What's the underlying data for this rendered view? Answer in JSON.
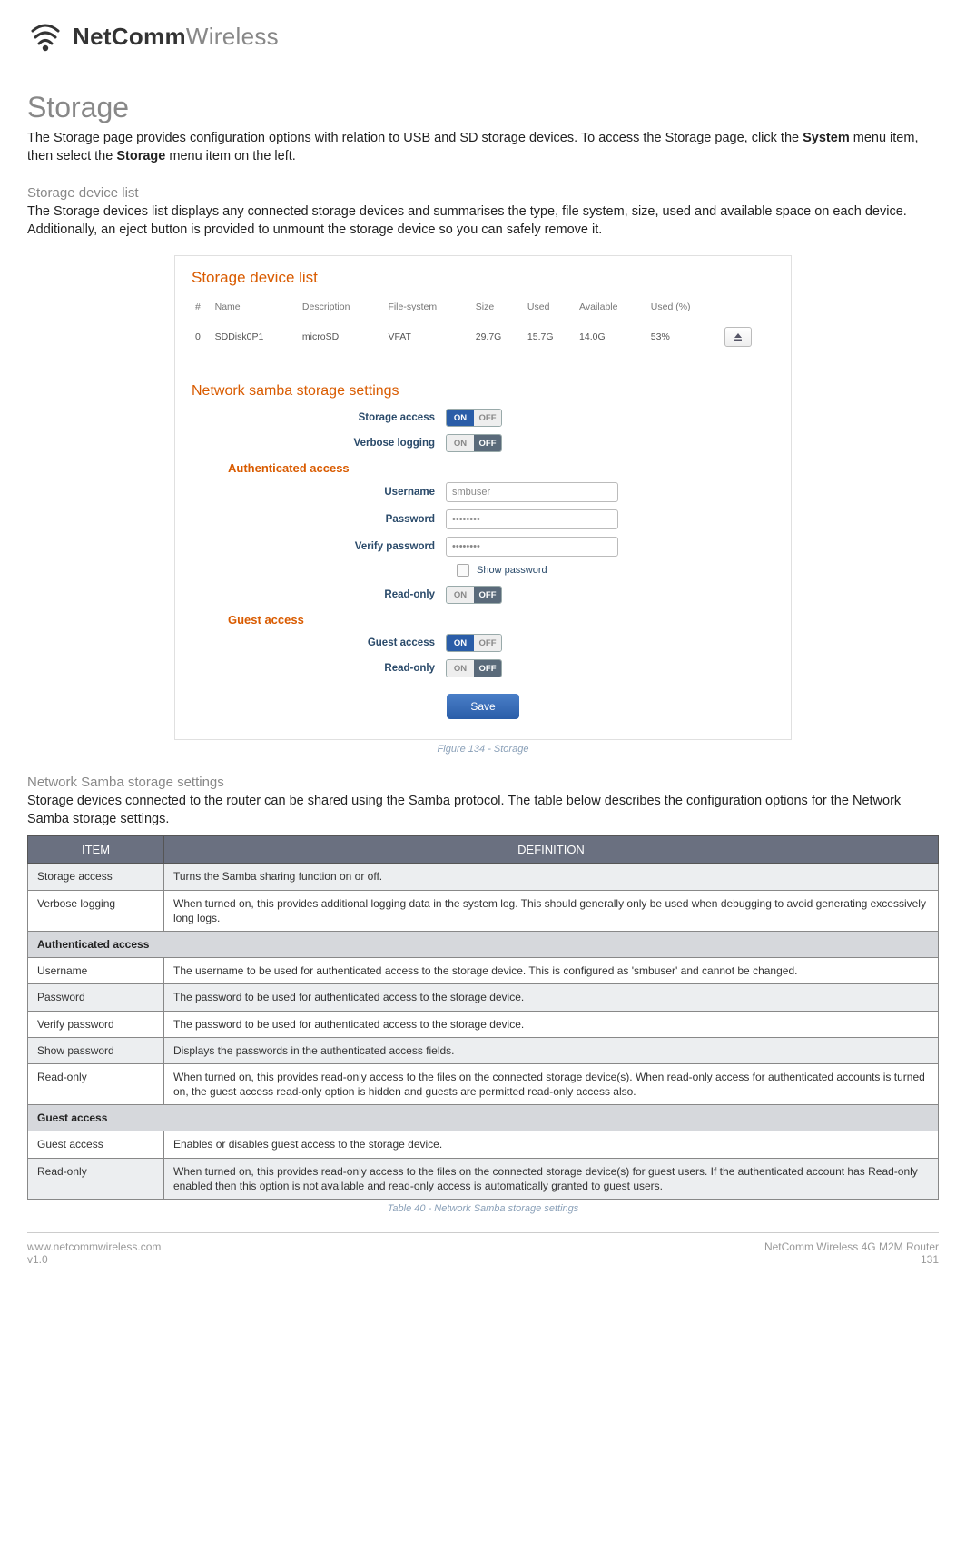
{
  "brand": {
    "bold": "NetComm",
    "light": "Wireless"
  },
  "title": "Storage",
  "intro": {
    "pre": "The Storage page provides configuration options with relation to USB and SD storage devices. To access the Storage page, click the ",
    "b1": "System",
    "mid": " menu item, then select the ",
    "b2": "Storage",
    "post": " menu item on the left."
  },
  "sec1": {
    "heading": "Storage device list",
    "body": "The Storage devices list displays any connected storage devices and summarises the type, file system, size, used and available space on each device. Additionally, an eject button is provided to unmount the storage device so you can safely remove it."
  },
  "panel": {
    "title1": "Storage device list",
    "headers": [
      "#",
      "Name",
      "Description",
      "File-system",
      "Size",
      "Used",
      "Available",
      "Used (%)"
    ],
    "row": [
      "0",
      "SDDisk0P1",
      "microSD",
      "VFAT",
      "29.7G",
      "15.7G",
      "14.0G",
      "53%"
    ],
    "title2": "Network samba storage settings",
    "labels": {
      "storage_access": "Storage access",
      "verbose": "Verbose logging",
      "auth_header": "Authenticated access",
      "username": "Username",
      "password": "Password",
      "verify": "Verify password",
      "showpw": "Show password",
      "readonly": "Read-only",
      "guest_header": "Guest access",
      "guest_access": "Guest access"
    },
    "values": {
      "username": "smbuser",
      "password": "••••••••",
      "verify": "••••••••"
    },
    "toggle": {
      "on": "ON",
      "off": "OFF"
    },
    "save": "Save"
  },
  "fig_caption": "Figure 134 - Storage",
  "sec2": {
    "heading": "Network Samba storage settings",
    "body": "Storage devices connected to the router can be shared using the Samba protocol. The table below describes the configuration options for the Network Samba storage settings."
  },
  "table": {
    "th": [
      "ITEM",
      "DEFINITION"
    ],
    "rows": [
      {
        "cls": "alt",
        "item": "Storage access",
        "def": "Turns the Samba sharing function on or off."
      },
      {
        "cls": "norm",
        "item": "Verbose logging",
        "def": "When turned on, this provides additional logging data in the system log. This should generally only be used when debugging to avoid generating excessively long logs."
      },
      {
        "cls": "section",
        "full": "Authenticated access"
      },
      {
        "cls": "norm",
        "item": "Username",
        "def": "The username to be used for authenticated access to the storage device. This is configured as 'smbuser' and cannot be changed."
      },
      {
        "cls": "alt",
        "item": "Password",
        "def": "The password to be used for authenticated access to the storage device."
      },
      {
        "cls": "norm",
        "item": "Verify password",
        "def": "The password to be used for authenticated access to the storage device."
      },
      {
        "cls": "alt",
        "item": "Show password",
        "def": "Displays the passwords in the authenticated access fields."
      },
      {
        "cls": "norm",
        "item": "Read-only",
        "def": "When turned on, this provides read-only access to the files on the connected storage device(s). When read-only access for authenticated accounts is turned on, the guest access read-only option is hidden and guests are permitted read-only access also."
      },
      {
        "cls": "section",
        "full": "Guest access"
      },
      {
        "cls": "norm",
        "item": "Guest access",
        "def": "Enables or disables guest access to the storage device."
      },
      {
        "cls": "alt",
        "item": "Read-only",
        "def": "When turned on, this provides read-only access to the files on the connected storage device(s) for guest users. If the authenticated account has Read-only enabled then this option is not available and read-only access is automatically granted to guest users."
      }
    ]
  },
  "tbl_caption": "Table 40 - Network Samba storage settings",
  "footer": {
    "url": "www.netcommwireless.com",
    "ver": "v1.0",
    "product": "NetComm Wireless 4G M2M Router",
    "page": "131"
  }
}
